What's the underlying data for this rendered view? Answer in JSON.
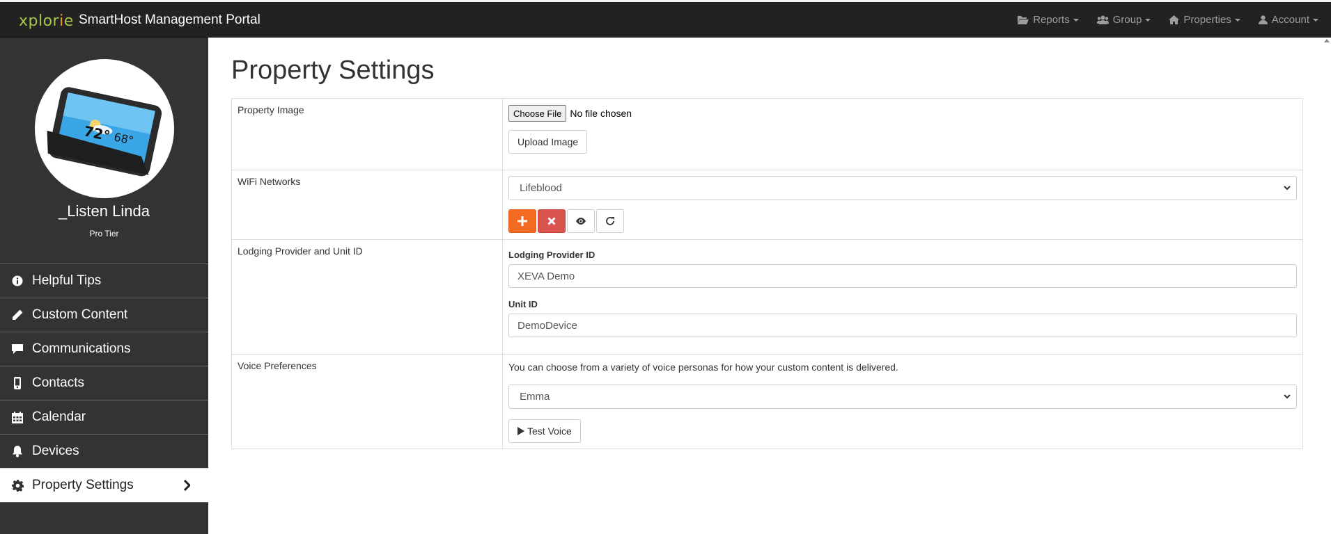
{
  "header": {
    "logo_text": "xplorie",
    "title": "SmartHost Management Portal",
    "nav": [
      {
        "label": "Reports",
        "icon": "folder-open-icon"
      },
      {
        "label": "Group",
        "icon": "users-icon"
      },
      {
        "label": "Properties",
        "icon": "home-icon"
      },
      {
        "label": "Account",
        "icon": "user-icon"
      }
    ]
  },
  "sidebar": {
    "device_display": {
      "temp_high": "72°",
      "temp_low": "68°"
    },
    "profile_name": "_Listen Linda",
    "tier": "Pro Tier",
    "items": [
      {
        "label": "Helpful Tips",
        "icon": "info-circle-icon"
      },
      {
        "label": "Custom Content",
        "icon": "pencil-icon"
      },
      {
        "label": "Communications",
        "icon": "comment-icon"
      },
      {
        "label": "Contacts",
        "icon": "mobile-phone-icon"
      },
      {
        "label": "Calendar",
        "icon": "calendar-icon"
      },
      {
        "label": "Devices",
        "icon": "bell-icon"
      },
      {
        "label": "Property Settings",
        "icon": "gear-icon",
        "active": true
      }
    ]
  },
  "main": {
    "title": "Property Settings",
    "rows": {
      "image": {
        "label": "Property Image",
        "choose_file": "Choose File",
        "file_status": "No file chosen",
        "upload_button": "Upload Image"
      },
      "wifi": {
        "label": "WiFi Networks",
        "selected": "Lifeblood"
      },
      "lodging": {
        "label": "Lodging Provider and Unit ID",
        "provider_label": "Lodging Provider ID",
        "provider_value": "XEVA Demo",
        "unit_label": "Unit ID",
        "unit_value": "DemoDevice"
      },
      "voice": {
        "label": "Voice Preferences",
        "description": "You can choose from a variety of voice personas for how your custom content is delivered.",
        "selected": "Emma",
        "test_button": "Test Voice"
      }
    }
  },
  "colors": {
    "navbar": "#222222",
    "sidebar": "#333333",
    "brand_green": "#a8c64a",
    "add_orange": "#f26b21",
    "delete_red": "#d9534f"
  }
}
